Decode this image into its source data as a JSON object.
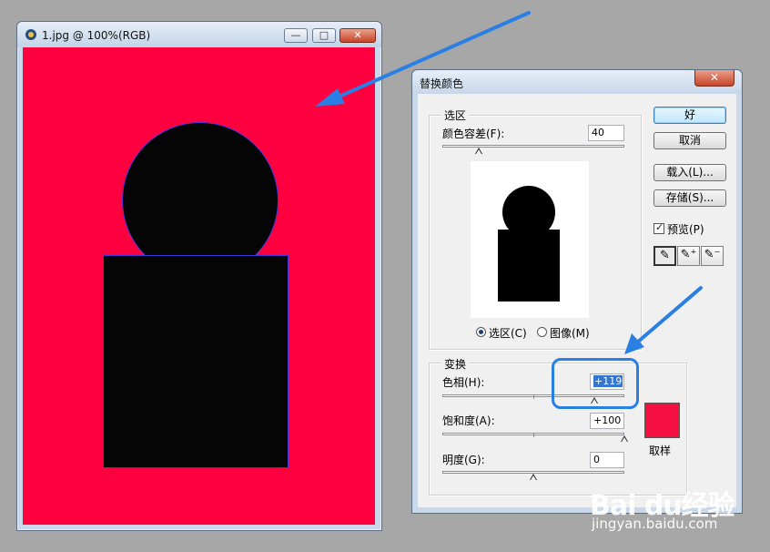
{
  "document_window": {
    "title": "1.jpg @ 100%(RGB)",
    "buttons": {
      "minimize": "—",
      "maximize": "□",
      "close": "✕"
    }
  },
  "canvas": {
    "background_color": "#fe0040",
    "shape_color": "#050505"
  },
  "dialog": {
    "title": "替换颜色",
    "close_label": "✕",
    "selection": {
      "group_label": "选区",
      "fuzziness_label": "颜色容差(F):",
      "fuzziness_value": "40",
      "fuzziness_fraction": 0.2,
      "radio_selection_label": "选区(C)",
      "radio_image_label": "图像(M)",
      "selected_radio": "selection"
    },
    "buttons": {
      "ok": "好",
      "cancel": "取消",
      "load": "载入(L)...",
      "save": "存储(S)..."
    },
    "preview_checkbox_label": "预览(P)",
    "preview_checked": true,
    "eyedropper_tools": [
      "eyedropper-icon",
      "eyedropper-plus-icon",
      "eyedropper-minus-icon"
    ],
    "transform": {
      "group_label": "变换",
      "hue_label": "色相(H):",
      "hue_value": "+119",
      "saturation_label": "饱和度(A):",
      "saturation_value": "+100",
      "lightness_label": "明度(G):",
      "lightness_value": "0",
      "swatch_label": "取样",
      "swatch_color": "#f31040"
    }
  },
  "watermark": {
    "brand": "Bai du经验",
    "url": "jingyan.baidu.com"
  },
  "annotation_color": "#2a7fe4"
}
